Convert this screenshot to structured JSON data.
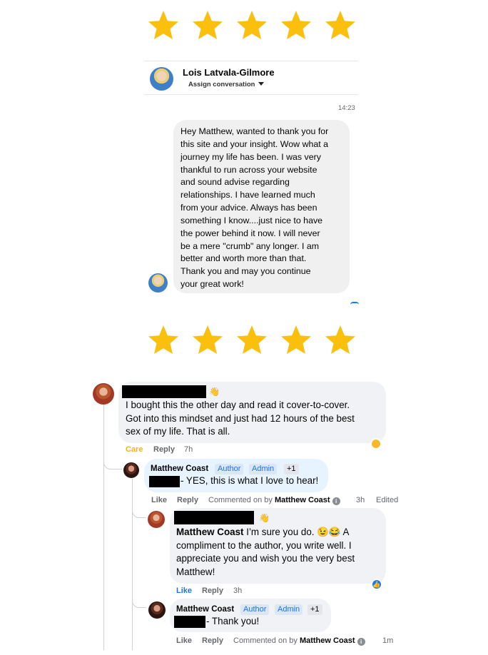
{
  "ratings": {
    "top_stars": 5,
    "middle_stars": 5,
    "star_color": "#fbbf0e"
  },
  "messenger": {
    "contact_name": "Lois Latvala-Gilmore",
    "assign_label": "Assign conversation",
    "timestamp": "14:23",
    "message_lines": [
      "Hey Matthew, wanted to thank you for",
      "this site and your insight. Wow what a",
      "journey my life has been. I was very",
      "thankful to run across your website",
      "and sound advise regarding",
      "relationships. I have learned much",
      "from your advice. Always has been",
      "something I know....just nice to have",
      "the power behind it now. I will never",
      "be a mere \"crumb\" any longer. I am",
      "better and worth more than that.",
      "Thank you and may you continue",
      "your great work!"
    ]
  },
  "comments": {
    "c1": {
      "text_lines": [
        "I bought this the other day and read it cover-to-cover.",
        "Got into this mindset and just had 12 hours of the best",
        "sex of my life. That is all."
      ],
      "reaction": "Care",
      "reply": "Reply",
      "time": "7h"
    },
    "r1": {
      "name": "Matthew Coast",
      "badges": [
        "Author",
        "Admin",
        "+1"
      ],
      "text": "- YES, this is what I love to hear!",
      "like": "Like",
      "reply": "Reply",
      "commented_prefix": "Commented on by",
      "commented_name": "Matthew Coast",
      "time": "3h",
      "edited": "Edited"
    },
    "c2": {
      "name": "Matthew Coast",
      "text_first": " I’m sure you do. 😉😂 A",
      "text_lines": [
        "compliment to the author, you write well. I",
        "appreciate you and wish you the very best",
        "Matthew!"
      ],
      "like": "Like",
      "reply": "Reply",
      "time": "3h"
    },
    "r2": {
      "name": "Matthew Coast",
      "badges": [
        "Author",
        "Admin",
        "+1"
      ],
      "text": "- Thank you!",
      "like": "Like",
      "reply": "Reply",
      "commented_prefix": "Commented on by",
      "commented_name": "Matthew Coast",
      "time": "1m"
    }
  }
}
